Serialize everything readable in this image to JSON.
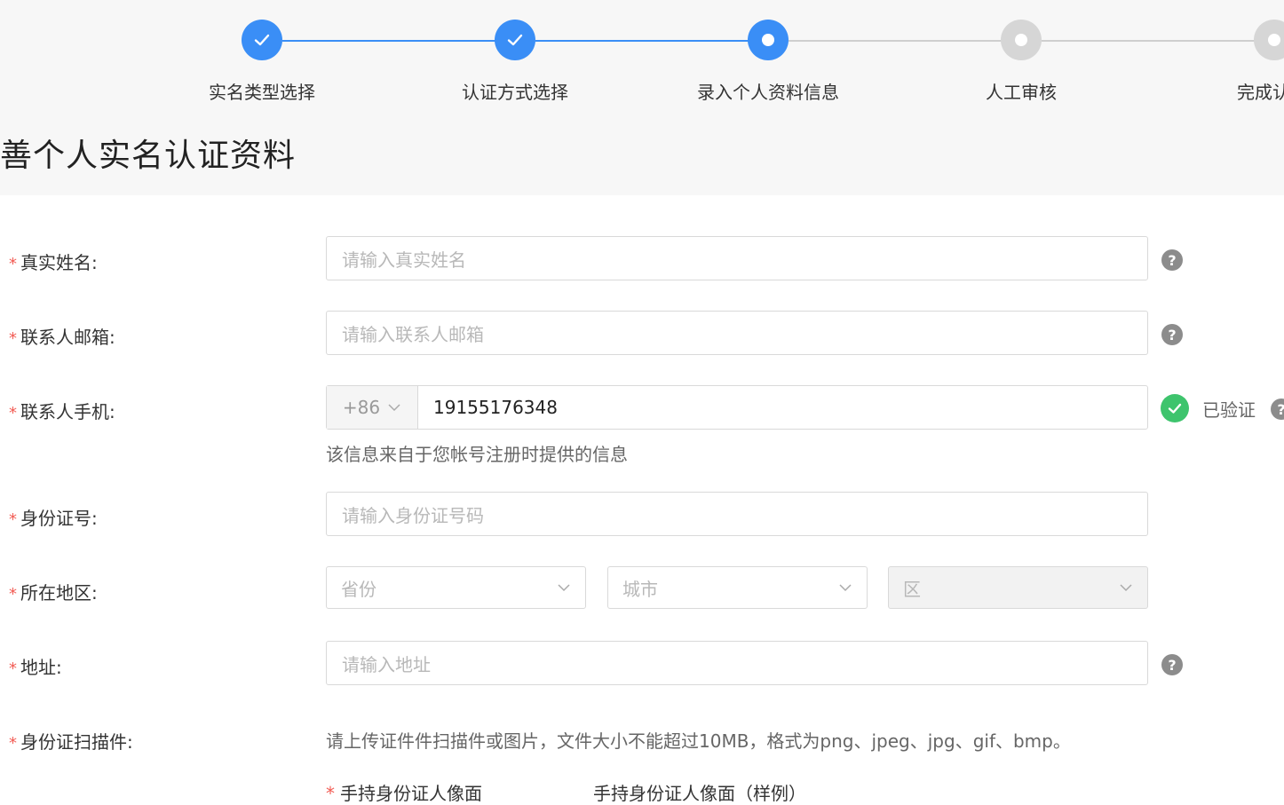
{
  "steps": [
    {
      "label": "实名类型选择",
      "state": "done"
    },
    {
      "label": "认证方式选择",
      "state": "done"
    },
    {
      "label": "录入个人资料信息",
      "state": "current"
    },
    {
      "label": "人工审核",
      "state": "todo"
    },
    {
      "label": "完成认",
      "state": "todo"
    }
  ],
  "colors": {
    "accent": "#3a8ef6",
    "required": "#f25c54",
    "verified": "#3ec46d",
    "inactive": "#d6d6d6"
  },
  "page_title": "善个人实名认证资料",
  "form": {
    "name": {
      "label": "真实姓名:",
      "placeholder": "请输入真实姓名"
    },
    "email": {
      "label": "联系人邮箱:",
      "placeholder": "请输入联系人邮箱"
    },
    "phone": {
      "label": "联系人手机:",
      "country_code": "+86",
      "value": "19155176348",
      "verified_text": "已验证",
      "hint": "该信息来自于您帐号注册时提供的信息"
    },
    "id_number": {
      "label": "身份证号:",
      "placeholder": "请输入身份证号码"
    },
    "region": {
      "label": "所在地区:",
      "province": "省份",
      "city": "城市",
      "district": "区"
    },
    "address": {
      "label": "地址:",
      "placeholder": "请输入地址"
    },
    "id_scan": {
      "label": "身份证扫描件:",
      "hint": "请上传证件件扫描件或图片，文件大小不能超过10MB，格式为png、jpeg、jpg、gif、bmp。",
      "sub_label_1": "手持身份证人像面",
      "sub_label_2": "手持身份证人像面（样例）"
    }
  },
  "icons": {
    "help": "question-circle-icon",
    "check": "check-circle-icon",
    "chevron": "chevron-down-icon"
  }
}
